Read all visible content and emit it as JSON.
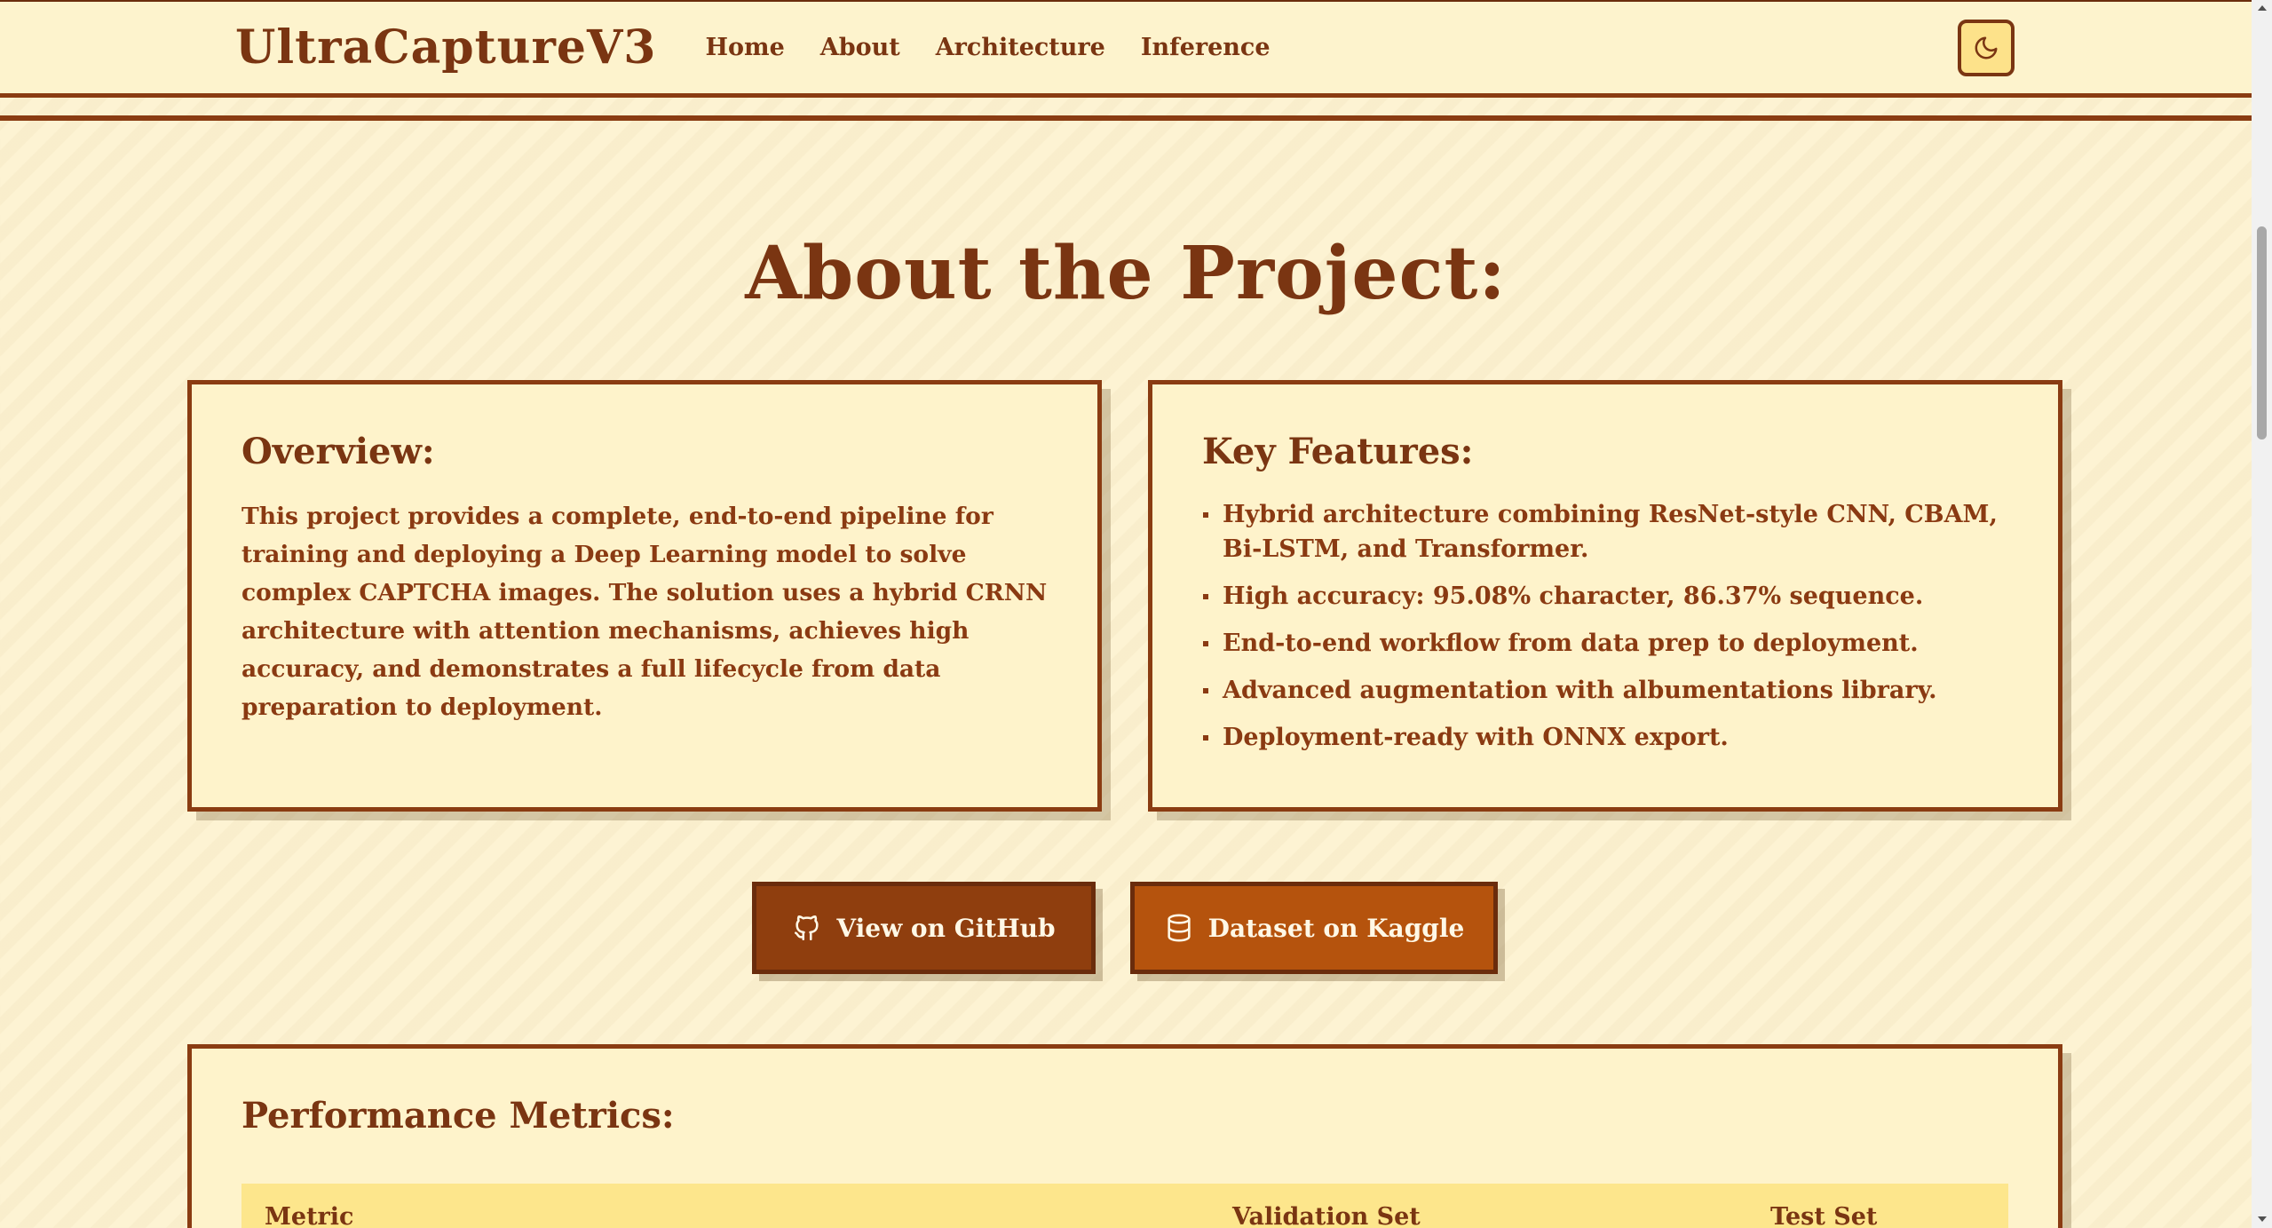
{
  "nav": {
    "brand": "UltraCaptureV3",
    "links": [
      "Home",
      "About",
      "Architecture",
      "Inference"
    ],
    "theme_icon": "moon-icon"
  },
  "about": {
    "title": "About the Project:",
    "overview": {
      "heading": "Overview:",
      "text": "This project provides a complete, end-to-end pipeline for training and deploying a Deep Learning model to solve complex CAPTCHA images. The solution uses a hybrid CRNN architecture with attention mechanisms, achieves high accuracy, and demonstrates a full lifecycle from data preparation to deployment."
    },
    "features": {
      "heading": "Key Features:",
      "items": [
        "Hybrid architecture combining ResNet-style CNN, CBAM, Bi-LSTM, and Transformer.",
        "High accuracy: 95.08% character, 86.37% sequence.",
        "End-to-end workflow from data prep to deployment.",
        "Advanced augmentation with albumentations library.",
        "Deployment-ready with ONNX export."
      ]
    }
  },
  "buttons": {
    "github": {
      "label": "View on GitHub",
      "icon": "github-icon"
    },
    "kaggle": {
      "label": "Dataset on Kaggle",
      "icon": "database-icon"
    }
  },
  "metrics": {
    "heading": "Performance Metrics:",
    "columns": [
      "Metric",
      "Validation Set",
      "Test Set"
    ]
  },
  "colors": {
    "primary": "#7a3512",
    "background": "#fdf3d3",
    "github_button": "#8f3e0e",
    "kaggle_button": "#b5530d",
    "table_header": "#fde68c"
  }
}
